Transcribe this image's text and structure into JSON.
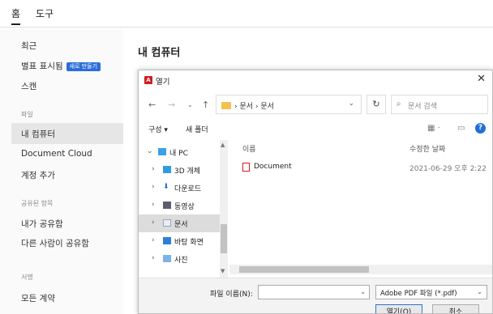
{
  "top_tabs": {
    "home": "홈",
    "tools": "도구"
  },
  "sidebar": {
    "recent": "최근",
    "starred": "별표 표시됨",
    "new_badge": "새로 만들기",
    "scan": "스캔",
    "files_section": "파일",
    "my_computer": "내 컴퓨터",
    "document_cloud": "Document Cloud",
    "add_account": "계정 추가",
    "shared_section": "공유된 항목",
    "shared_by_me": "내가 공유함",
    "shared_by_others": "다른 사람이 공유함",
    "signature_section": "서명",
    "all_agreements": "모든 계약"
  },
  "main": {
    "title": "내 컴퓨터"
  },
  "dialog": {
    "title": "열기",
    "address": "› 문서 › 문서",
    "search_placeholder": "문서 검색",
    "toolbar": {
      "organize": "구성 ▾",
      "new_folder": "새 폴더"
    },
    "tree": [
      {
        "label": "내 PC",
        "expanded": true
      },
      {
        "label": "3D 개체"
      },
      {
        "label": "다운로드"
      },
      {
        "label": "동영상"
      },
      {
        "label": "문서",
        "selected": true
      },
      {
        "label": "바탕 화면"
      },
      {
        "label": "사진"
      }
    ],
    "columns": {
      "name": "이름",
      "modified": "수정한 날짜"
    },
    "files": [
      {
        "name": "Document",
        "modified": "2021-06-29 오후 2:22"
      }
    ],
    "file_name_label": "파일 이름(N):",
    "file_name_value": "",
    "file_type": "Adobe PDF 파일 (*.pdf)",
    "open_button": "열기(O)",
    "cancel_button": "취소"
  },
  "colors": {
    "accent": "#2c6ddb",
    "pdf_red": "#d21c1c",
    "folder": "#f2c14e"
  }
}
